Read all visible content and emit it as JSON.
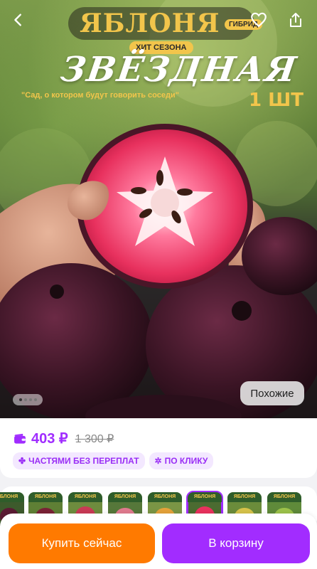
{
  "banner": {
    "title": "ЯБЛОНЯ",
    "hybrid_badge": "ГИБРИД",
    "hit_badge": "ХИТ СЕЗОНА",
    "name": "ЗВЁЗДНАЯ",
    "quote": "\"Сад, о котором будут говорить соседи\"",
    "quantity": "1 ШТ"
  },
  "gallery": {
    "similar_button": "Похожие",
    "pages": 4,
    "current_page": 1
  },
  "price": {
    "current": "403 ₽",
    "old": "1 300 ₽"
  },
  "chips": [
    {
      "icon": "split-icon",
      "label": "ЧАСТЯМИ БЕЗ ПЕРЕПЛАТ"
    },
    {
      "icon": "click-icon",
      "label": "ПО КЛИКУ"
    }
  ],
  "thumbnails": [
    {
      "label": "ЯБЛОНЯ"
    },
    {
      "label": "ЯБЛОНЯ"
    },
    {
      "label": "ЯБЛОНЯ"
    },
    {
      "label": "ЯБЛОНЯ"
    },
    {
      "label": "ЯБЛОНЯ"
    },
    {
      "label": "ЯБЛОНЯ"
    },
    {
      "label": "ЯБЛОНЯ"
    },
    {
      "label": "ЯБЛОНЯ"
    }
  ],
  "actions": {
    "buy_now": "Купить сейчас",
    "add_to_cart": "В корзину"
  },
  "colors": {
    "accent_purple": "#a22cff",
    "accent_orange": "#ff7a00",
    "banner_gold": "#f2c54b"
  }
}
